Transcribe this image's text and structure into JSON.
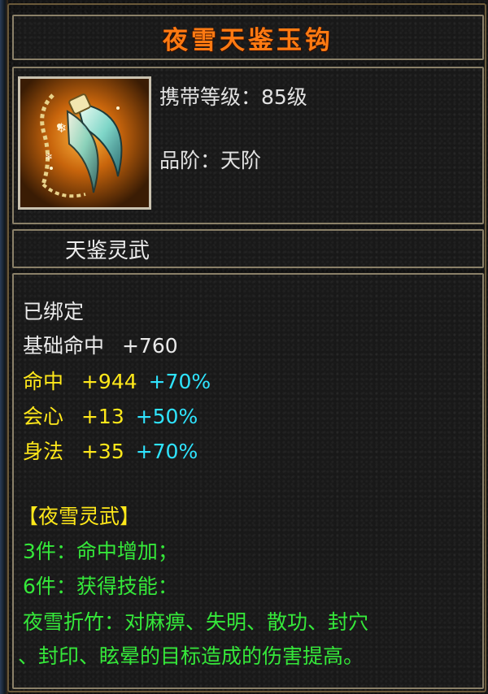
{
  "item": {
    "name": "夜雪天鉴玉钩",
    "carry_level": "携带等级：85级",
    "grade": "品阶：天阶",
    "category": "天鉴灵武",
    "icon": "jade-hook-weapon-icon"
  },
  "stats": {
    "bound": "已绑定",
    "base_hit": {
      "label": "基础命中",
      "value": "+760"
    },
    "hit": {
      "label": "命中",
      "value": "+944",
      "bonus": "+70%"
    },
    "crit": {
      "label": "会心",
      "value": "+13",
      "bonus": "+50%"
    },
    "agility": {
      "label": "身法",
      "value": "+35",
      "bonus": "+70%"
    }
  },
  "set": {
    "name": "【夜雪灵武】",
    "bonus3": "3件：命中增加；",
    "bonus6": "6件：获得技能：",
    "skill_line1": "夜雪折竹：对麻痹、失明、散功、封穴",
    "skill_line2": "、封印、眩晕的目标造成的伤害提高。"
  },
  "colors": {
    "title": "#ff7a12",
    "yellow": "#ffe81a",
    "cyan": "#2fe4ff",
    "green": "#35e83a",
    "white": "#eaeaea"
  }
}
